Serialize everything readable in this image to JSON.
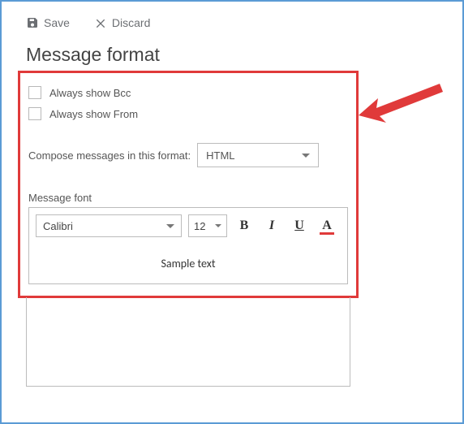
{
  "toolbar": {
    "save": "Save",
    "discard": "Discard"
  },
  "title": "Message format",
  "options": {
    "always_show_bcc": "Always show Bcc",
    "always_show_from": "Always show From"
  },
  "compose": {
    "label": "Compose messages in this format:",
    "value": "HTML"
  },
  "font": {
    "section_label": "Message font",
    "family": "Calibri",
    "size": "12",
    "bold": "B",
    "italic": "I",
    "underline": "U",
    "color": "A",
    "sample": "Sample text"
  }
}
